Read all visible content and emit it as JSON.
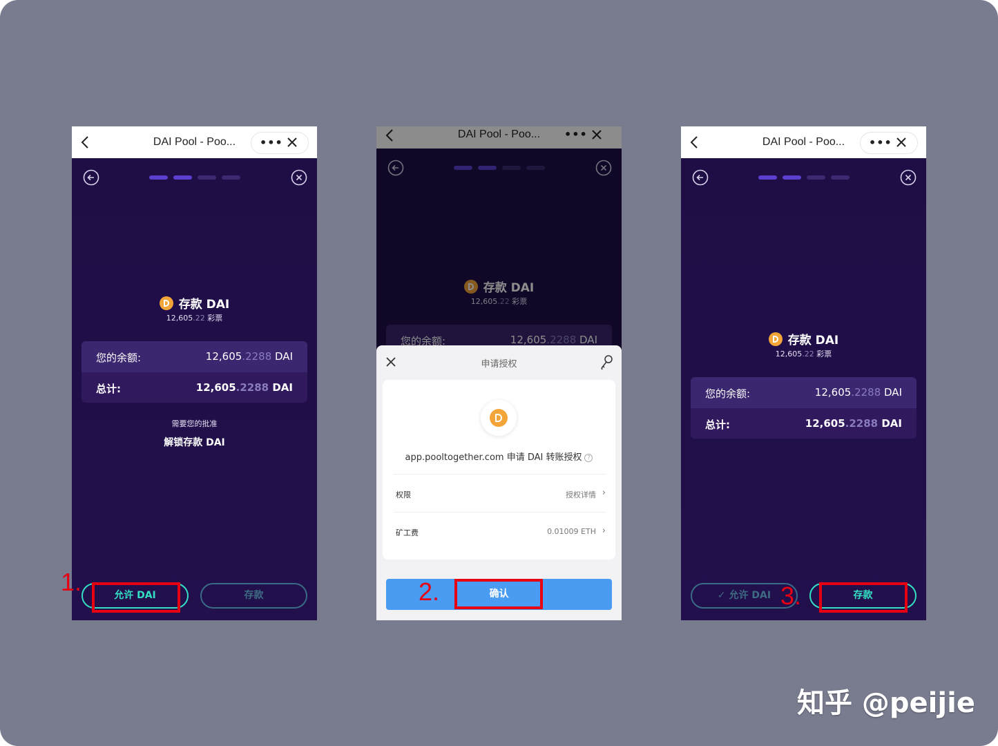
{
  "browser": {
    "title": "DAI Pool - Poo...",
    "more": "•••"
  },
  "screen1": {
    "deposit_title": "存款 DAI",
    "tickets_main": "12,605",
    "tickets_dim": ".22",
    "tickets_unit": " 彩票",
    "balance_label": "您的余额:",
    "balance_main": "12,605",
    "balance_dim": ".2288",
    "balance_unit": " DAI",
    "total_label": "总计:",
    "total_main": "12,605",
    "total_dim": ".2288",
    "total_unit": " DAI",
    "need_approval": "需要您的批准",
    "unlock": "解锁存款 DAI",
    "allow_button": "允许 DAI",
    "deposit_button": "存款",
    "step_label": "1."
  },
  "screen2": {
    "deposit_title": "存款 DAI",
    "tickets_main": "12,605",
    "tickets_dim": ".22",
    "tickets_unit": " 彩票",
    "balance_label": "您的余额:",
    "balance_main": "12,605",
    "balance_dim": ".2288",
    "balance_unit": " DAI",
    "sheet_title": "申请授权",
    "request_text": "app.pooltogether.com 申请 DAI 转账授权",
    "help_mark": "?",
    "perm_label": "权限",
    "perm_value": "授权详情",
    "fee_label": "矿工费",
    "fee_value": "0.01009 ETH",
    "confirm_button": "确认",
    "step_label": "2."
  },
  "screen3": {
    "deposit_title": "存款 DAI",
    "tickets_main": "12,605",
    "tickets_dim": ".22",
    "tickets_unit": " 彩票",
    "balance_label": "您的余额:",
    "balance_main": "12,605",
    "balance_dim": ".2288",
    "balance_unit": " DAI",
    "total_label": "总计:",
    "total_main": "12,605",
    "total_dim": ".2288",
    "total_unit": " DAI",
    "allow_done_button": "✓ 允许 DAI",
    "deposit_button": "存款",
    "step_label": "3."
  },
  "watermark": "知乎 @peijie",
  "colors": {
    "accent_teal": "#33e0c4",
    "highlight_red": "#e60012",
    "confirm_blue": "#4a9cf2",
    "app_bg": "#1f0f45"
  }
}
